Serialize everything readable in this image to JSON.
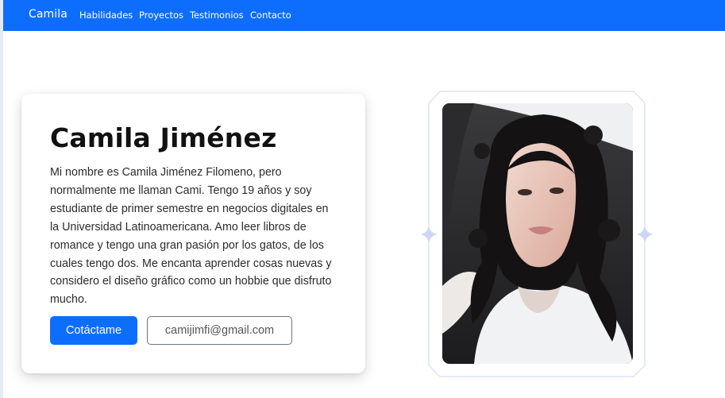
{
  "navbar": {
    "brand": "Camila",
    "links": [
      "Habilidades",
      "Proyectos",
      "Testimonios",
      "Contacto"
    ]
  },
  "hero": {
    "name": "Camila Jiménez",
    "bio": "Mi nombre es Camila Jiménez Filomeno, pero normalmente me llaman Cami. Tengo 19 años y soy estudiante de primer semestre en negocios digitales en la Universidad Latinoamericana. Amo leer libros de romance y tengo una gran pasión por los gatos, de los cuales tengo dos. Me encanta aprender cosas nuevas y considero el diseño gráfico como un hobbie que disfruto mucho.",
    "contact_button": "Cotáctame",
    "email_button": "camijimfi@gmail.com"
  },
  "colors": {
    "primary": "#0d6efd",
    "frame": "#dde3f5",
    "sparkle": "#cdd7f4"
  },
  "icons": {
    "decoration": "sparkle-icon"
  }
}
